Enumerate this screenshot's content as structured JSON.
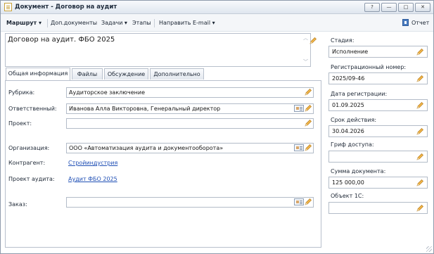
{
  "window": {
    "title": "Документ - Договор на аудит",
    "controls": [
      "?",
      "—",
      "□",
      "✕"
    ]
  },
  "toolbar": {
    "route": "Маршрут",
    "dop_docs": "Доп.документы",
    "tasks": "Задачи",
    "stages": "Этапы",
    "send_email": "Направить E-mail",
    "report": "Отчет"
  },
  "subject": "Договор на аудит. ФБО 2025",
  "tabs": [
    {
      "label": "Общая информация",
      "active": true
    },
    {
      "label": "Файлы",
      "active": false
    },
    {
      "label": "Обсуждение",
      "active": false
    },
    {
      "label": "Дополнительно",
      "active": false
    }
  ],
  "general": {
    "rubric_label": "Рубрика:",
    "rubric_value": "Аудиторское заключение",
    "responsible_label": "Ответственный:",
    "responsible_value": "Иванова Алла Викторовна, Генеральный директор",
    "project_label": "Проект:",
    "project_value": "",
    "organization_label": "Организация:",
    "organization_value": "ООО «Автоматизация аудита и документооборота»",
    "counterparty_label": "Контрагент:",
    "counterparty_value": "Стройиндустрия",
    "audit_project_label": "Проект аудита:",
    "audit_project_value": "Аудит ФБО 2025",
    "order_label": "Заказ:",
    "order_value": ""
  },
  "right_panel": {
    "stage_label": "Стадия:",
    "stage_value": "Исполнение",
    "reg_number_label": "Регистрационный номер:",
    "reg_number_value": "2025/09-46",
    "reg_date_label": "Дата регистрации:",
    "reg_date_value": "01.09.2025",
    "validity_label": "Срок действия:",
    "validity_value": "30.04.2026",
    "access_label": "Гриф доступа:",
    "access_value": "",
    "amount_label": "Сумма документа:",
    "amount_value": "125 000,00",
    "object1c_label": "Объект 1С:",
    "object1c_value": ""
  },
  "colors": {
    "accent_pencil": "#e8a33a",
    "link": "#1f4fb5",
    "border": "#b3bcc8"
  },
  "icons": {
    "pencil": "pencil-icon",
    "card": "contact-card-icon",
    "document": "document-icon",
    "report": "report-icon"
  }
}
